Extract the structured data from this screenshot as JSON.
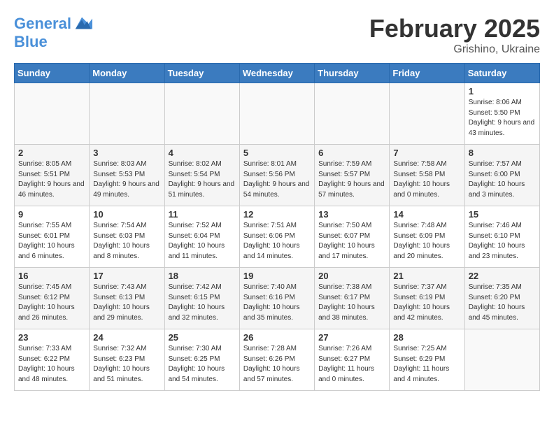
{
  "header": {
    "logo_line1": "General",
    "logo_line2": "Blue",
    "month": "February 2025",
    "location": "Grishino, Ukraine"
  },
  "weekdays": [
    "Sunday",
    "Monday",
    "Tuesday",
    "Wednesday",
    "Thursday",
    "Friday",
    "Saturday"
  ],
  "weeks": [
    [
      {
        "day": "",
        "info": ""
      },
      {
        "day": "",
        "info": ""
      },
      {
        "day": "",
        "info": ""
      },
      {
        "day": "",
        "info": ""
      },
      {
        "day": "",
        "info": ""
      },
      {
        "day": "",
        "info": ""
      },
      {
        "day": "1",
        "info": "Sunrise: 8:06 AM\nSunset: 5:50 PM\nDaylight: 9 hours and 43 minutes."
      }
    ],
    [
      {
        "day": "2",
        "info": "Sunrise: 8:05 AM\nSunset: 5:51 PM\nDaylight: 9 hours and 46 minutes."
      },
      {
        "day": "3",
        "info": "Sunrise: 8:03 AM\nSunset: 5:53 PM\nDaylight: 9 hours and 49 minutes."
      },
      {
        "day": "4",
        "info": "Sunrise: 8:02 AM\nSunset: 5:54 PM\nDaylight: 9 hours and 51 minutes."
      },
      {
        "day": "5",
        "info": "Sunrise: 8:01 AM\nSunset: 5:56 PM\nDaylight: 9 hours and 54 minutes."
      },
      {
        "day": "6",
        "info": "Sunrise: 7:59 AM\nSunset: 5:57 PM\nDaylight: 9 hours and 57 minutes."
      },
      {
        "day": "7",
        "info": "Sunrise: 7:58 AM\nSunset: 5:58 PM\nDaylight: 10 hours and 0 minutes."
      },
      {
        "day": "8",
        "info": "Sunrise: 7:57 AM\nSunset: 6:00 PM\nDaylight: 10 hours and 3 minutes."
      }
    ],
    [
      {
        "day": "9",
        "info": "Sunrise: 7:55 AM\nSunset: 6:01 PM\nDaylight: 10 hours and 6 minutes."
      },
      {
        "day": "10",
        "info": "Sunrise: 7:54 AM\nSunset: 6:03 PM\nDaylight: 10 hours and 8 minutes."
      },
      {
        "day": "11",
        "info": "Sunrise: 7:52 AM\nSunset: 6:04 PM\nDaylight: 10 hours and 11 minutes."
      },
      {
        "day": "12",
        "info": "Sunrise: 7:51 AM\nSunset: 6:06 PM\nDaylight: 10 hours and 14 minutes."
      },
      {
        "day": "13",
        "info": "Sunrise: 7:50 AM\nSunset: 6:07 PM\nDaylight: 10 hours and 17 minutes."
      },
      {
        "day": "14",
        "info": "Sunrise: 7:48 AM\nSunset: 6:09 PM\nDaylight: 10 hours and 20 minutes."
      },
      {
        "day": "15",
        "info": "Sunrise: 7:46 AM\nSunset: 6:10 PM\nDaylight: 10 hours and 23 minutes."
      }
    ],
    [
      {
        "day": "16",
        "info": "Sunrise: 7:45 AM\nSunset: 6:12 PM\nDaylight: 10 hours and 26 minutes."
      },
      {
        "day": "17",
        "info": "Sunrise: 7:43 AM\nSunset: 6:13 PM\nDaylight: 10 hours and 29 minutes."
      },
      {
        "day": "18",
        "info": "Sunrise: 7:42 AM\nSunset: 6:15 PM\nDaylight: 10 hours and 32 minutes."
      },
      {
        "day": "19",
        "info": "Sunrise: 7:40 AM\nSunset: 6:16 PM\nDaylight: 10 hours and 35 minutes."
      },
      {
        "day": "20",
        "info": "Sunrise: 7:38 AM\nSunset: 6:17 PM\nDaylight: 10 hours and 38 minutes."
      },
      {
        "day": "21",
        "info": "Sunrise: 7:37 AM\nSunset: 6:19 PM\nDaylight: 10 hours and 42 minutes."
      },
      {
        "day": "22",
        "info": "Sunrise: 7:35 AM\nSunset: 6:20 PM\nDaylight: 10 hours and 45 minutes."
      }
    ],
    [
      {
        "day": "23",
        "info": "Sunrise: 7:33 AM\nSunset: 6:22 PM\nDaylight: 10 hours and 48 minutes."
      },
      {
        "day": "24",
        "info": "Sunrise: 7:32 AM\nSunset: 6:23 PM\nDaylight: 10 hours and 51 minutes."
      },
      {
        "day": "25",
        "info": "Sunrise: 7:30 AM\nSunset: 6:25 PM\nDaylight: 10 hours and 54 minutes."
      },
      {
        "day": "26",
        "info": "Sunrise: 7:28 AM\nSunset: 6:26 PM\nDaylight: 10 hours and 57 minutes."
      },
      {
        "day": "27",
        "info": "Sunrise: 7:26 AM\nSunset: 6:27 PM\nDaylight: 11 hours and 0 minutes."
      },
      {
        "day": "28",
        "info": "Sunrise: 7:25 AM\nSunset: 6:29 PM\nDaylight: 11 hours and 4 minutes."
      },
      {
        "day": "",
        "info": ""
      }
    ]
  ]
}
